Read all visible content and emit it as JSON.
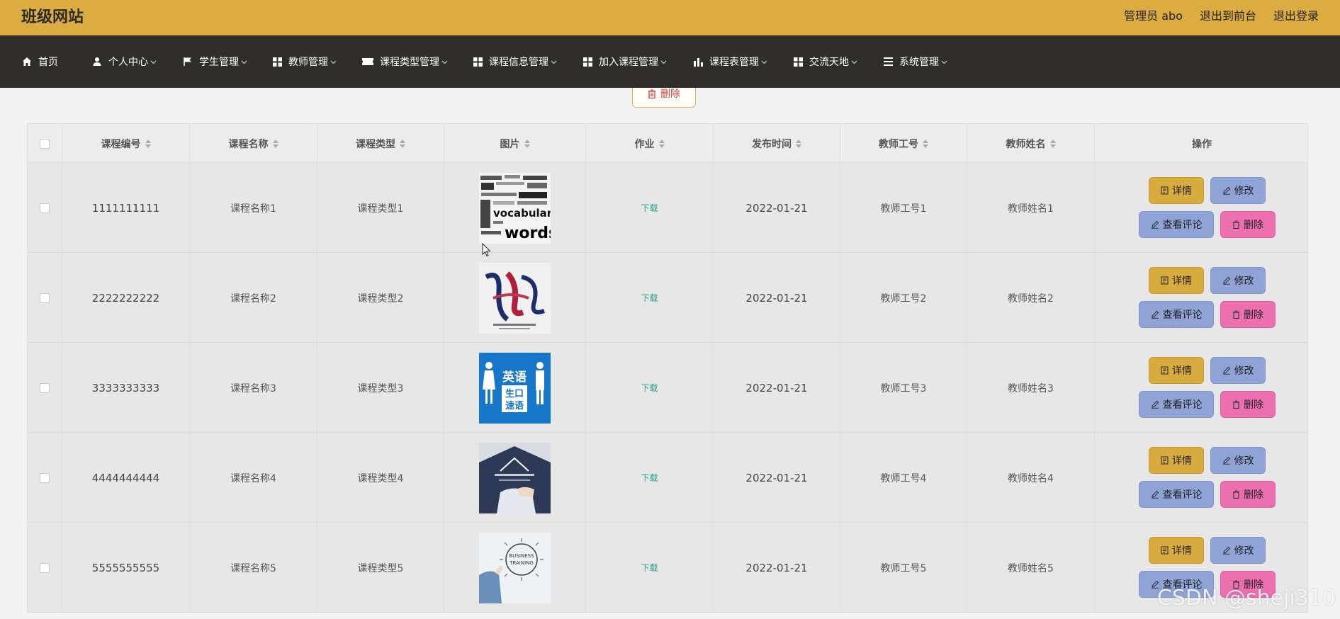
{
  "header": {
    "site_title": "班级网站",
    "admin_label": "管理员 abo",
    "back_label": "退出到前台",
    "logout_label": "退出登录"
  },
  "nav": [
    {
      "label": "首页",
      "icon": "home-icon"
    },
    {
      "label": "个人中心",
      "icon": "user-icon"
    },
    {
      "label": "学生管理",
      "icon": "flag-icon"
    },
    {
      "label": "教师管理",
      "icon": "grid-icon"
    },
    {
      "label": "课程类型管理",
      "icon": "ticket-icon"
    },
    {
      "label": "课程信息管理",
      "icon": "grid-icon"
    },
    {
      "label": "加入课程管理",
      "icon": "grid-icon"
    },
    {
      "label": "课程表管理",
      "icon": "bar-chart-icon"
    },
    {
      "label": "交流天地",
      "icon": "grid-icon"
    },
    {
      "label": "系统管理",
      "icon": "menu-icon"
    }
  ],
  "toolbar": {
    "delete_label": "删除"
  },
  "table": {
    "columns": [
      "课程编号",
      "课程名称",
      "课程类型",
      "图片",
      "作业",
      "发布时间",
      "教师工号",
      "教师姓名",
      "操作"
    ],
    "rows": [
      {
        "code": "1111111111",
        "name": "课程名称1",
        "type": "课程类型1",
        "image": "vocabulary-words-image",
        "homework": "下载",
        "date": "2022-01-21",
        "teacher_id": "教师工号1",
        "teacher_name": "教师姓名1"
      },
      {
        "code": "2222222222",
        "name": "课程名称2",
        "type": "课程类型2",
        "image": "calligraphy-image",
        "homework": "下载",
        "date": "2022-01-21",
        "teacher_id": "教师工号2",
        "teacher_name": "教师姓名2"
      },
      {
        "code": "3333333333",
        "name": "课程名称3",
        "type": "课程类型3",
        "image": "english-oral-image",
        "homework": "下载",
        "date": "2022-01-21",
        "teacher_id": "教师工号3",
        "teacher_name": "教师姓名3"
      },
      {
        "code": "4444444444",
        "name": "课程名称4",
        "type": "课程类型4",
        "image": "study-desk-image",
        "homework": "下载",
        "date": "2022-01-21",
        "teacher_id": "教师工号4",
        "teacher_name": "教师姓名4"
      },
      {
        "code": "5555555555",
        "name": "课程名称5",
        "type": "课程类型5",
        "image": "business-training-image",
        "homework": "下载",
        "date": "2022-01-21",
        "teacher_id": "教师工号5",
        "teacher_name": "教师姓名5"
      }
    ],
    "actions": {
      "detail": "详情",
      "edit": "修改",
      "comment": "查看评论",
      "delete": "删除"
    }
  },
  "watermark": "CSDN @sheji310",
  "colors": {
    "topbar": "#dcac40",
    "navbar": "#2f2e2b",
    "detail": "#d8ab3f",
    "edit": "#8fa3d6",
    "delete": "#ec6fb0"
  }
}
